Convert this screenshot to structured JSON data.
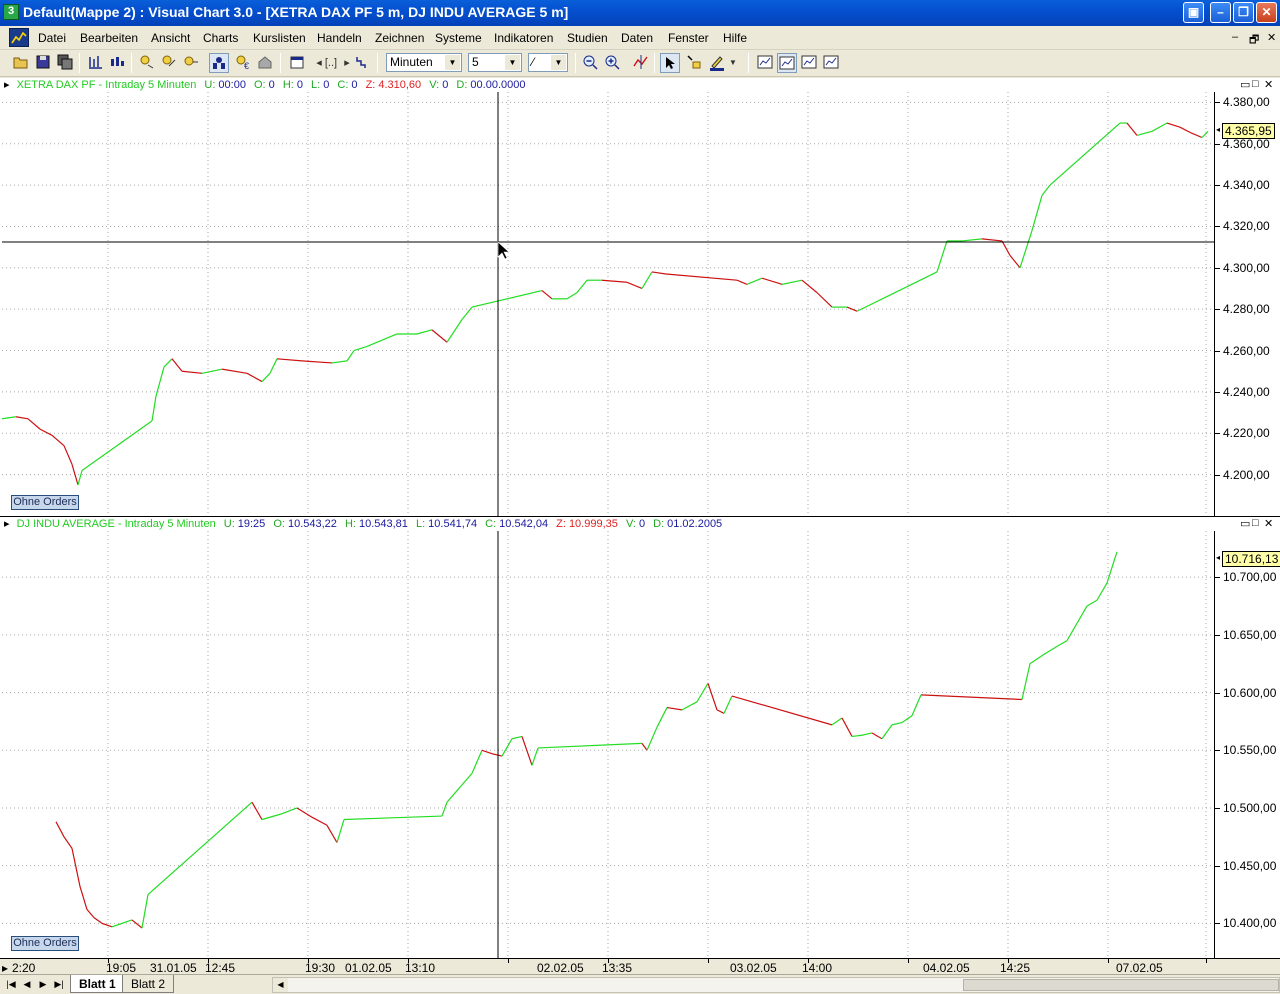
{
  "window": {
    "title": "Default(Mappe 2) : Visual Chart  3.0 - [XETRA DAX PF 5 m, DJ INDU AVERAGE 5 m]",
    "app_icon_glyph": "3"
  },
  "menu": {
    "items": [
      "Datei",
      "Bearbeiten",
      "Ansicht",
      "Charts",
      "Kurslisten",
      "Handeln",
      "Zeichnen",
      "Systeme",
      "Indikatoren",
      "Studien",
      "Daten",
      "Fenster",
      "Hilfe"
    ],
    "mdi_controls": [
      "–",
      "🗗",
      "✕"
    ]
  },
  "toolbar": {
    "period_unit": "Minuten",
    "period_value": "5",
    "line_style": "⁄",
    "icons": [
      "open-icon",
      "save-icon",
      "save-all-icon",
      "bar-chart-icon",
      "candle-chart-icon",
      "cursor-icon",
      "text-icon",
      "zoom-out-icon",
      "zoom-in-icon"
    ]
  },
  "panes": [
    {
      "id": "dax",
      "header": {
        "name": "XETRA DAX PF - Intraday 5 Minuten",
        "u_label": "U:",
        "u_value": "00:00",
        "o_label": "O:",
        "o_value": "0",
        "h_label": "H:",
        "h_value": "0",
        "l_label": "L:",
        "l_value": "0",
        "c_label": "C:",
        "c_value": "0",
        "z_label": "Z:",
        "z_value": "4.310,60",
        "v_label": "V:",
        "v_value": "0",
        "d_label": "D:",
        "d_value": "00.00.0000"
      },
      "orders_button": "Ohne Orders",
      "last_price": "4.365,95",
      "axis_labels": [
        "4.380,00",
        "4.360,00",
        "4.340,00",
        "4.320,00",
        "4.300,00",
        "4.280,00",
        "4.260,00",
        "4.240,00",
        "4.220,00",
        "4.200,00"
      ]
    },
    {
      "id": "dj",
      "header": {
        "name": "DJ INDU AVERAGE - Intraday 5 Minuten",
        "u_label": "U:",
        "u_value": "19:25",
        "o_label": "O:",
        "o_value": "10.543,22",
        "h_label": "H:",
        "h_value": "10.543,81",
        "l_label": "L:",
        "l_value": "10.541,74",
        "c_label": "C:",
        "c_value": "10.542,04",
        "z_label": "Z:",
        "z_value": "10.999,35",
        "v_label": "V:",
        "v_value": "0",
        "d_label": "D:",
        "d_value": "01.02.2005"
      },
      "orders_button": "Ohne Orders",
      "last_price": "10.716,13",
      "axis_labels": [
        "10.700,00",
        "10.650,00",
        "10.600,00",
        "10.550,00",
        "10.500,00",
        "10.450,00",
        "10.400,00"
      ]
    }
  ],
  "time_axis": [
    "2:20",
    "19:05",
    "31.01.05",
    "12:45",
    "19:30",
    "01.02.05",
    "13:10",
    "02.02.05",
    "13:35",
    "03.02.05",
    "14:00",
    "04.02.05",
    "14:25",
    "07.02.05"
  ],
  "sheets": {
    "tabs": [
      "Blatt 1",
      "Blatt 2"
    ],
    "active": "Blatt 1"
  },
  "colors": {
    "up": "#22dd22",
    "down": "#cc1111",
    "grid": "#a8a8a8",
    "header_name": "#22cc22",
    "header_label": "#22aa22",
    "header_value": "#1a1aa0",
    "header_z": "#dd2222"
  },
  "chart_data": [
    {
      "type": "line",
      "series": [
        {
          "name": "XETRA DAX PF - Intraday 5 Minuten",
          "points": [
            [
              0,
              4227
            ],
            [
              14,
              4228
            ],
            [
              26,
              4227
            ],
            [
              38,
              4222
            ],
            [
              50,
              4219
            ],
            [
              62,
              4214
            ],
            [
              70,
              4205
            ],
            [
              76,
              4195
            ],
            [
              80,
              4202
            ],
            [
              150,
              4226
            ],
            [
              154,
              4238
            ],
            [
              162,
              4252
            ],
            [
              170,
              4256
            ],
            [
              180,
              4250
            ],
            [
              200,
              4249
            ],
            [
              220,
              4251
            ],
            [
              245,
              4249
            ],
            [
              260,
              4245
            ],
            [
              268,
              4249
            ],
            [
              275,
              4256
            ],
            [
              300,
              4255
            ],
            [
              330,
              4254
            ],
            [
              345,
              4255
            ],
            [
              352,
              4260
            ],
            [
              365,
              4262
            ],
            [
              380,
              4265
            ],
            [
              395,
              4268
            ],
            [
              415,
              4268
            ],
            [
              430,
              4270
            ],
            [
              445,
              4264
            ],
            [
              460,
              4275
            ],
            [
              470,
              4281
            ],
            [
              540,
              4289
            ],
            [
              550,
              4285
            ],
            [
              565,
              4285
            ],
            [
              575,
              4288
            ],
            [
              585,
              4294
            ],
            [
              600,
              4294
            ],
            [
              625,
              4293
            ],
            [
              640,
              4290
            ],
            [
              650,
              4298
            ],
            [
              664,
              4297
            ],
            [
              735,
              4294
            ],
            [
              745,
              4292
            ],
            [
              760,
              4295
            ],
            [
              780,
              4292
            ],
            [
              800,
              4294
            ],
            [
              815,
              4288
            ],
            [
              830,
              4281
            ],
            [
              845,
              4281
            ],
            [
              855,
              4279
            ],
            [
              935,
              4298
            ],
            [
              945,
              4313
            ],
            [
              960,
              4313
            ],
            [
              980,
              4314
            ],
            [
              1000,
              4313
            ],
            [
              1008,
              4306
            ],
            [
              1018,
              4300
            ],
            [
              1030,
              4318
            ],
            [
              1040,
              4335
            ],
            [
              1048,
              4340
            ],
            [
              1118,
              4370
            ],
            [
              1125,
              4370
            ],
            [
              1135,
              4364
            ],
            [
              1150,
              4366
            ],
            [
              1165,
              4370
            ],
            [
              1178,
              4368
            ],
            [
              1190,
              4365
            ],
            [
              1200,
              4363
            ],
            [
              1206,
              4366
            ]
          ]
        }
      ],
      "ylim": [
        4180,
        4385
      ]
    },
    {
      "type": "line",
      "series": [
        {
          "name": "DJ INDU AVERAGE - Intraday 5 Minuten",
          "points": [
            [
              54,
              10488
            ],
            [
              62,
              10475
            ],
            [
              70,
              10465
            ],
            [
              78,
              10432
            ],
            [
              85,
              10412
            ],
            [
              92,
              10405
            ],
            [
              100,
              10400
            ],
            [
              110,
              10397
            ],
            [
              120,
              10400
            ],
            [
              130,
              10403
            ],
            [
              140,
              10396
            ],
            [
              146,
              10425
            ],
            [
              250,
              10505
            ],
            [
              260,
              10490
            ],
            [
              280,
              10495
            ],
            [
              295,
              10500
            ],
            [
              310,
              10492
            ],
            [
              325,
              10485
            ],
            [
              335,
              10470
            ],
            [
              342,
              10490
            ],
            [
              440,
              10493
            ],
            [
              445,
              10505
            ],
            [
              460,
              10520
            ],
            [
              470,
              10530
            ],
            [
              480,
              10550
            ],
            [
              490,
              10547
            ],
            [
              500,
              10545
            ],
            [
              510,
              10560
            ],
            [
              520,
              10562
            ],
            [
              530,
              10537
            ],
            [
              536,
              10552
            ],
            [
              640,
              10556
            ],
            [
              645,
              10550
            ],
            [
              655,
              10570
            ],
            [
              665,
              10587
            ],
            [
              680,
              10585
            ],
            [
              695,
              10592
            ],
            [
              706,
              10608
            ],
            [
              715,
              10585
            ],
            [
              722,
              10582
            ],
            [
              730,
              10597
            ],
            [
              830,
              10572
            ],
            [
              840,
              10578
            ],
            [
              850,
              10562
            ],
            [
              860,
              10563
            ],
            [
              870,
              10565
            ],
            [
              880,
              10560
            ],
            [
              890,
              10572
            ],
            [
              900,
              10574
            ],
            [
              910,
              10580
            ],
            [
              919,
              10598
            ],
            [
              1020,
              10594
            ],
            [
              1028,
              10625
            ],
            [
              1040,
              10632
            ],
            [
              1055,
              10640
            ],
            [
              1065,
              10645
            ],
            [
              1075,
              10660
            ],
            [
              1085,
              10675
            ],
            [
              1095,
              10680
            ],
            [
              1105,
              10695
            ],
            [
              1115,
              10722
            ]
          ]
        }
      ],
      "ylim": [
        10370,
        10740
      ]
    }
  ]
}
